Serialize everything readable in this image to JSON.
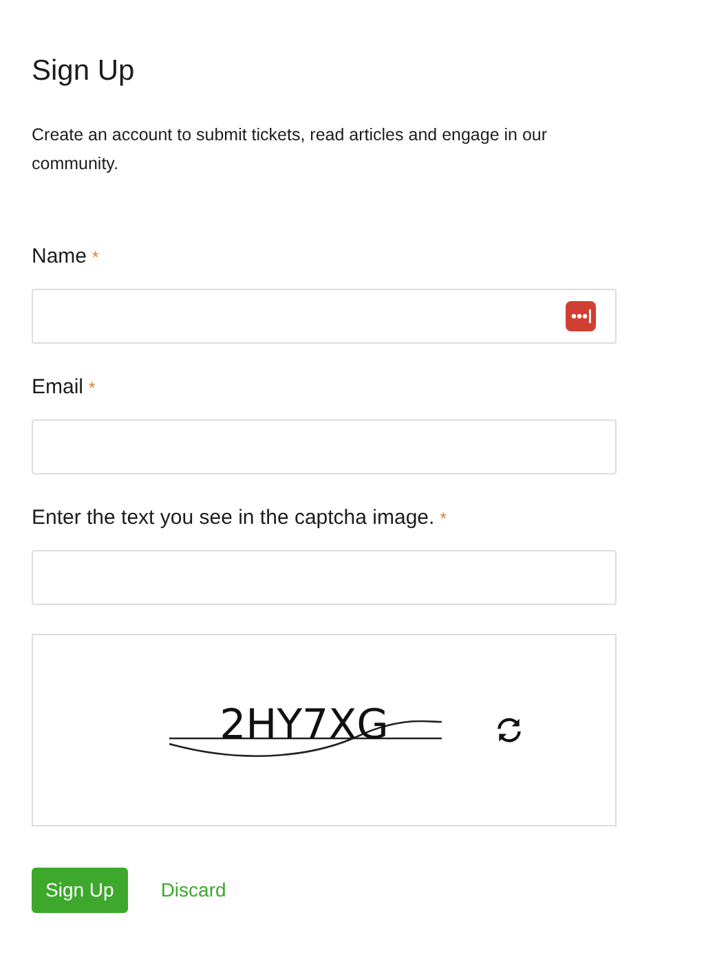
{
  "title": "Sign Up",
  "description": "Create an account to submit tickets, read articles and engage in our community.",
  "fields": [
    {
      "label": "Name",
      "required_mark": "*",
      "password_manager_icon": true
    },
    {
      "label": "Email",
      "required_mark": "*",
      "password_manager_icon": false
    },
    {
      "label": "Enter the text you see in the captcha image.",
      "required_mark": "*",
      "password_manager_icon": false
    }
  ],
  "captcha": {
    "text": "2HY7XG"
  },
  "buttons": [
    {
      "label": "Sign Up",
      "kind": "primary"
    },
    {
      "label": "Discard",
      "kind": "link"
    }
  ]
}
